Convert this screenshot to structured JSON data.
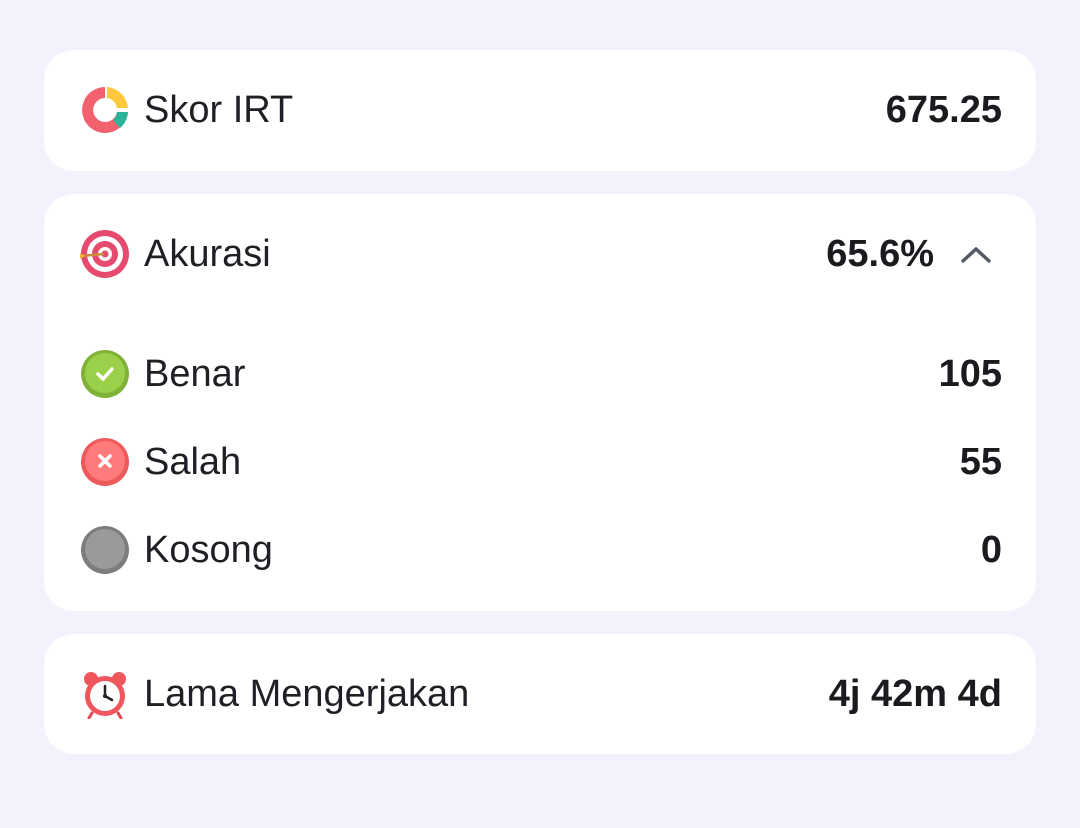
{
  "irt": {
    "label": "Skor IRT",
    "value": "675.25",
    "icon": "donut-chart-icon"
  },
  "accuracy": {
    "label": "Akurasi",
    "value": "65.6%",
    "icon": "target-icon",
    "expanded": true,
    "toggle_icon": "chevron-up-icon",
    "items": [
      {
        "label": "Benar",
        "value": "105",
        "icon": "check-circle-icon",
        "color": "#8cc63f"
      },
      {
        "label": "Salah",
        "value": "55",
        "icon": "x-circle-icon",
        "color": "#ff6b6b"
      },
      {
        "label": "Kosong",
        "value": "0",
        "icon": "empty-circle-icon",
        "color": "#8d8d8d"
      }
    ]
  },
  "duration": {
    "label": "Lama Mengerjakan",
    "value": "4j 42m 4d",
    "icon": "alarm-clock-icon"
  },
  "colors": {
    "background": "#f1f2fb",
    "card": "#ffffff"
  }
}
